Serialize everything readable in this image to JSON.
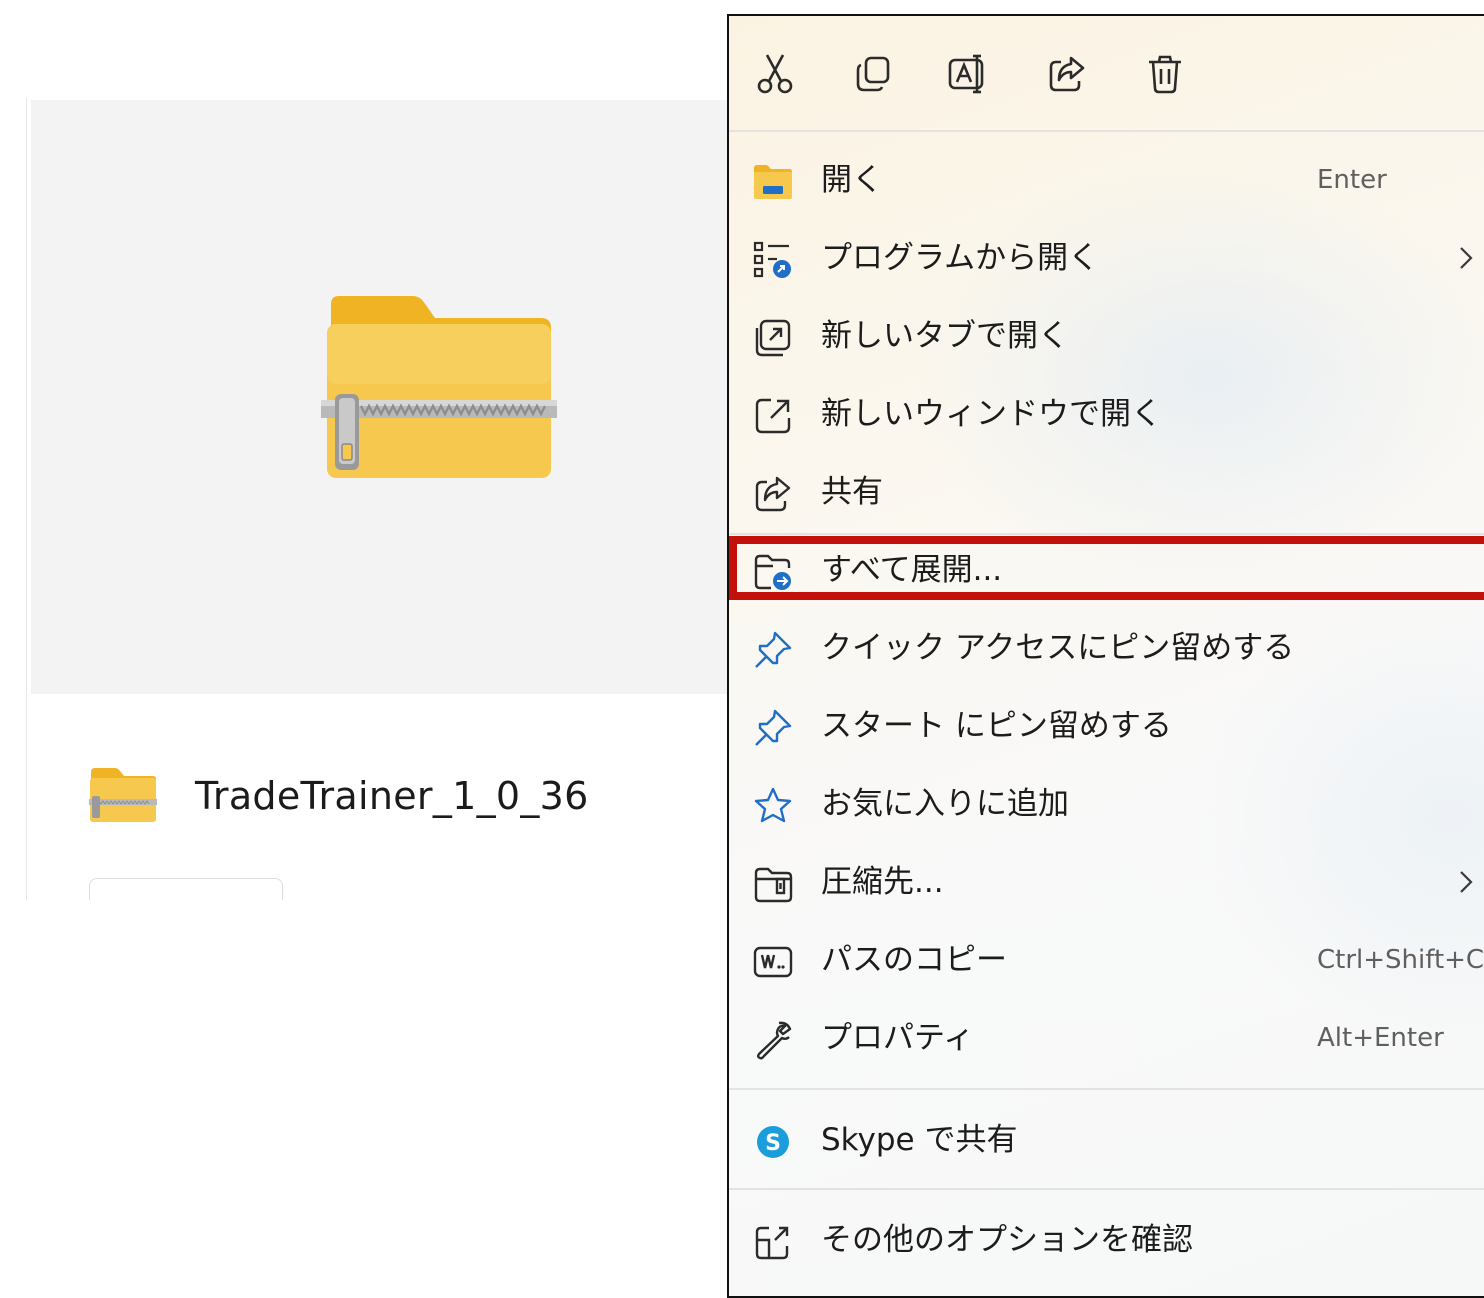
{
  "preview": {
    "file_name": "TradeTrainer_1_0_36"
  },
  "colors": {
    "folder_yellow": "#f6c94e",
    "folder_tab": "#f0b324",
    "icon_blue": "#1f6fc7",
    "highlight_red": "#c4100a",
    "skype_blue": "#1c9ddb"
  },
  "context_menu": {
    "toolbar": [
      {
        "icon": "cut-icon"
      },
      {
        "icon": "copy-icon"
      },
      {
        "icon": "rename-icon"
      },
      {
        "icon": "share-icon"
      },
      {
        "icon": "delete-icon"
      }
    ],
    "items": [
      {
        "icon": "open-folder-icon",
        "label": "開く",
        "shortcut": "Enter"
      },
      {
        "icon": "open-with-icon",
        "label": "プログラムから開く",
        "submenu": true
      },
      {
        "icon": "new-tab-icon",
        "label": "新しいタブで開く"
      },
      {
        "icon": "new-window-icon",
        "label": "新しいウィンドウで開く"
      },
      {
        "icon": "share-icon",
        "label": "共有"
      },
      {
        "icon": "extract-all-icon",
        "label": "すべて展開...",
        "highlighted": true
      },
      {
        "icon": "pin-icon",
        "label": "クイック アクセスにピン留めする"
      },
      {
        "icon": "pin-icon",
        "label": "スタート にピン留めする"
      },
      {
        "icon": "star-icon",
        "label": "お気に入りに追加"
      },
      {
        "icon": "compress-icon",
        "label": "圧縮先...",
        "submenu": true
      },
      {
        "icon": "copy-path-icon",
        "label": "パスのコピー",
        "shortcut": "Ctrl+Shift+C"
      },
      {
        "icon": "wrench-icon",
        "label": "プロパティ",
        "shortcut": "Alt+Enter"
      },
      {
        "icon": "skype-icon",
        "label": "Skype で共有"
      },
      {
        "icon": "more-options-icon",
        "label": "その他のオプションを確認"
      }
    ]
  }
}
